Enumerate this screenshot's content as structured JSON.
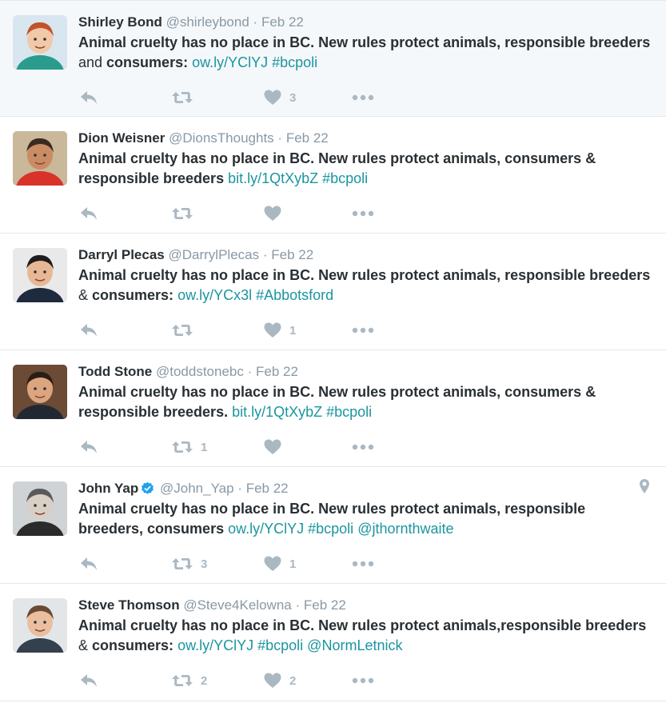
{
  "tweets": [
    {
      "name": "Shirley Bond",
      "handle": "@shirleybond",
      "separator": "·",
      "date": "Feb 22",
      "verified": false,
      "has_location": false,
      "text_segments": [
        {
          "t": "Animal cruelty has no place in BC. New rules protect animals, responsible breeders ",
          "k": "bold"
        },
        {
          "t": "and",
          "k": "plain"
        },
        {
          "t": " consumers: ",
          "k": "bold"
        },
        {
          "t": "ow.ly/YClYJ",
          "k": "link"
        },
        {
          "t": " ",
          "k": "bold"
        },
        {
          "t": "#bcpoli",
          "k": "link"
        }
      ],
      "retweets": "",
      "likes": "3"
    },
    {
      "name": "Dion Weisner",
      "handle": "@DionsThoughts",
      "separator": "·",
      "date": "Feb 22",
      "verified": false,
      "has_location": false,
      "text_segments": [
        {
          "t": "Animal cruelty has no place in BC. New rules protect animals, consumers & responsible breeders ",
          "k": "bold"
        },
        {
          "t": "bit.ly/1QtXybZ",
          "k": "link"
        },
        {
          "t": " ",
          "k": "bold"
        },
        {
          "t": "#bcpoli",
          "k": "link"
        }
      ],
      "retweets": "",
      "likes": ""
    },
    {
      "name": "Darryl Plecas",
      "handle": "@DarrylPlecas",
      "separator": "·",
      "date": "Feb 22",
      "verified": false,
      "has_location": false,
      "text_segments": [
        {
          "t": "Animal cruelty has no place in BC. New rules protect animals, responsible breeders ",
          "k": "bold"
        },
        {
          "t": "&",
          "k": "plain"
        },
        {
          "t": " consumers: ",
          "k": "bold"
        },
        {
          "t": "ow.ly/YCx3l",
          "k": "link"
        },
        {
          "t": " ",
          "k": "bold"
        },
        {
          "t": "#Abbotsford",
          "k": "link"
        }
      ],
      "retweets": "",
      "likes": "1"
    },
    {
      "name": "Todd Stone",
      "handle": "@toddstonebc",
      "separator": "·",
      "date": "Feb 22",
      "verified": false,
      "has_location": false,
      "text_segments": [
        {
          "t": "Animal cruelty has no place in BC. New rules protect animals, consumers & responsible breeders. ",
          "k": "bold"
        },
        {
          "t": "bit.ly/1QtXybZ",
          "k": "link"
        },
        {
          "t": " ",
          "k": "bold"
        },
        {
          "t": "#bcpoli",
          "k": "link"
        }
      ],
      "retweets": "1",
      "likes": ""
    },
    {
      "name": "John Yap",
      "handle": "@John_Yap",
      "separator": "·",
      "date": "Feb 22",
      "verified": true,
      "has_location": true,
      "text_segments": [
        {
          "t": "Animal cruelty has no place in BC. New rules protect animals, responsible breeders, consumers ",
          "k": "bold"
        },
        {
          "t": "ow.ly/YClYJ",
          "k": "link"
        },
        {
          "t": " ",
          "k": "bold"
        },
        {
          "t": "#bcpoli",
          "k": "link"
        },
        {
          "t": " ",
          "k": "bold"
        },
        {
          "t": "@jthornthwaite",
          "k": "link"
        }
      ],
      "retweets": "3",
      "likes": "1"
    },
    {
      "name": "Steve Thomson",
      "handle": "@Steve4Kelowna",
      "separator": "·",
      "date": "Feb 22",
      "verified": false,
      "has_location": false,
      "text_segments": [
        {
          "t": "Animal cruelty has no place in BC. New rules protect animals,responsible breeders ",
          "k": "bold"
        },
        {
          "t": "&",
          "k": "plain"
        },
        {
          "t": " consumers: ",
          "k": "bold"
        },
        {
          "t": "ow.ly/YClYJ",
          "k": "link"
        },
        {
          "t": " ",
          "k": "bold"
        },
        {
          "t": "#bcpoli",
          "k": "link"
        },
        {
          "t": " ",
          "k": "bold"
        },
        {
          "t": "@NormLetnick",
          "k": "link"
        }
      ],
      "retweets": "2",
      "likes": "2"
    }
  ],
  "icons": {
    "reply": "reply-icon",
    "retweet": "retweet-icon",
    "like": "heart-icon",
    "more": "more-dots-icon",
    "verified": "verified-badge-icon",
    "location": "location-pin-icon"
  },
  "colors": {
    "link": "#1b95a0",
    "muted": "#8899a6",
    "action": "#aab8c2",
    "verified": "#1da1f2",
    "highlight_bg": "#f5f8fa"
  }
}
